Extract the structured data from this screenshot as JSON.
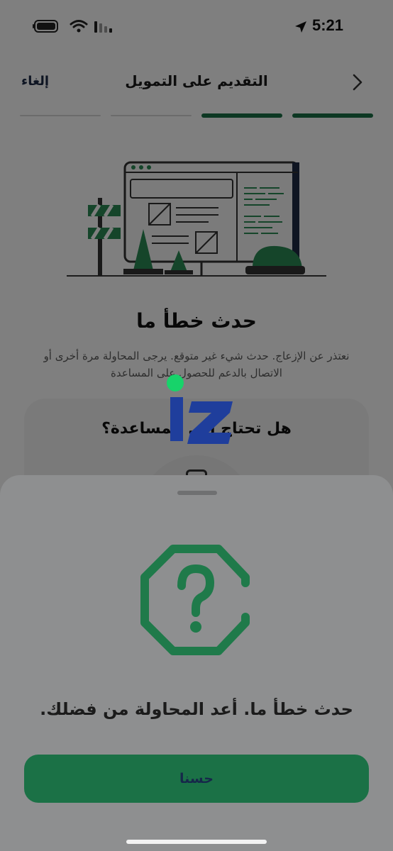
{
  "status_bar": {
    "time": "5:21"
  },
  "header": {
    "title": "التقديم على التمويل",
    "cancel_label": "إلغاء"
  },
  "progress": {
    "total_steps": 4,
    "completed_steps": 2
  },
  "error": {
    "title": "حدث خطأ ما",
    "description": "نعتذر عن الإزعاج. حدث شيء غير متوقع. يرجى المحاولة مرة أخرى أو الاتصال بالدعم للحصول على المساعدة"
  },
  "help": {
    "title": "هل تحتاج إلى المساعدة؟"
  },
  "sheet": {
    "message": "حدث خطأ ما. أعد المحاولة من فضلك.",
    "ok_label": "حسنا"
  },
  "colors": {
    "brand_green": "#1b7146",
    "icon_green": "#1f7a4a",
    "navy": "#1c2a46",
    "logo_blue": "#1f3e9c"
  },
  "icons": {
    "battery": "battery-icon",
    "wifi": "wifi-icon",
    "signal": "signal-icon",
    "location": "location-arrow-icon",
    "back": "chevron-right-icon",
    "sheet": "question-octagon-icon",
    "help": "chat-icon"
  }
}
